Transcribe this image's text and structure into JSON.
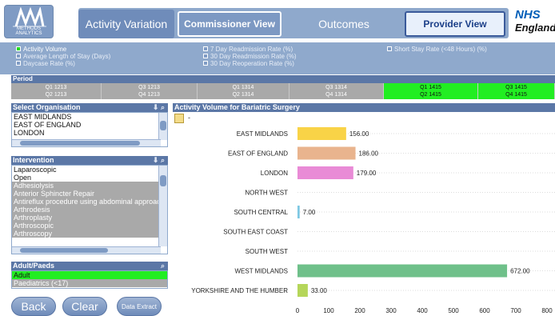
{
  "logo": {
    "text": "METHODS ANALYTICS"
  },
  "nav": {
    "activity_variation": "Activity Variation",
    "commissioner_view": "Commissioner View",
    "outcomes": "Outcomes",
    "provider_view": "Provider View"
  },
  "nhs": {
    "mark": "NHS",
    "region": "England"
  },
  "measures": {
    "col1": [
      "Activity Volume",
      "Average Length of Stay (Days)",
      "Daycase Rate (%)"
    ],
    "col2": [
      "7 Day Readmission Rate (%)",
      "30 Day Readmission Rate (%)",
      "30 Day Reoperation Rate (%)"
    ],
    "col3": [
      "Short Stay Rate (<48 Hours) (%)"
    ],
    "active": "Activity Volume"
  },
  "period": {
    "title": "Period",
    "cells": [
      {
        "top": "Q1 1213",
        "bottom": "Q2 1213",
        "selected": false
      },
      {
        "top": "Q3 1213",
        "bottom": "Q4 1213",
        "selected": false
      },
      {
        "top": "Q1 1314",
        "bottom": "Q2 1314",
        "selected": false
      },
      {
        "top": "Q3 1314",
        "bottom": "Q4 1314",
        "selected": false
      },
      {
        "top": "Q1 1415",
        "bottom": "Q2 1415",
        "selected": true
      },
      {
        "top": "Q3 1415",
        "bottom": "Q4 1415",
        "selected": true
      }
    ]
  },
  "organisation": {
    "title": "Select Organisation",
    "items": [
      "EAST MIDLANDS",
      "EAST OF ENGLAND",
      "LONDON"
    ]
  },
  "intervention": {
    "title": "Intervention",
    "items": [
      {
        "label": "Laparoscopic",
        "state": "normal"
      },
      {
        "label": "Open",
        "state": "normal"
      },
      {
        "label": "Adhesiolysis",
        "state": "grey"
      },
      {
        "label": "Anterior Sphincter Repair",
        "state": "grey"
      },
      {
        "label": "Antireflux procedure using abdominal approach",
        "state": "grey"
      },
      {
        "label": "Arthrodesis",
        "state": "grey"
      },
      {
        "label": "Arthroplasty",
        "state": "grey"
      },
      {
        "label": "Arthroscopic",
        "state": "grey"
      },
      {
        "label": "Arthroscopy",
        "state": "grey"
      }
    ]
  },
  "adult_paeds": {
    "title": "Adult/Paeds",
    "items": [
      {
        "label": "Adult",
        "state": "green"
      },
      {
        "label": "Paediatrics (<17)",
        "state": "grey"
      }
    ]
  },
  "buttons": {
    "back": "Back",
    "clear": "Clear",
    "data_extract": "Data Extract"
  },
  "chart_title": "Activity Volume for Bariatric Surgery",
  "dash": "-",
  "colors": {
    "panel_header": "#5b77a6",
    "nav_band": "#8fa9cc",
    "selected_green": "#22ee22"
  },
  "chart_data": {
    "type": "bar",
    "orientation": "horizontal",
    "title": "Activity Volume for Bariatric Surgery",
    "categories": [
      "EAST MIDLANDS",
      "EAST OF ENGLAND",
      "LONDON",
      "NORTH WEST",
      "SOUTH CENTRAL",
      "SOUTH EAST COAST",
      "SOUTH WEST",
      "WEST MIDLANDS",
      "YORKSHIRE AND THE HUMBER"
    ],
    "values": [
      156.0,
      186.0,
      179.0,
      null,
      7.0,
      null,
      null,
      672.0,
      33.0
    ],
    "labels": [
      "156.00",
      "186.00",
      "179.00",
      "",
      "7.00",
      "",
      "",
      "672.00",
      "33.00"
    ],
    "colors": [
      "#f9d347",
      "#e9b48e",
      "#e98bd6",
      "#cccccc",
      "#7ec8e3",
      "#cccccc",
      "#cccccc",
      "#6fc08a",
      "#b5d65a"
    ],
    "xlim": [
      0,
      800
    ],
    "xticks": [
      0,
      100,
      200,
      300,
      400,
      500,
      600,
      700,
      800
    ],
    "grid": true
  }
}
